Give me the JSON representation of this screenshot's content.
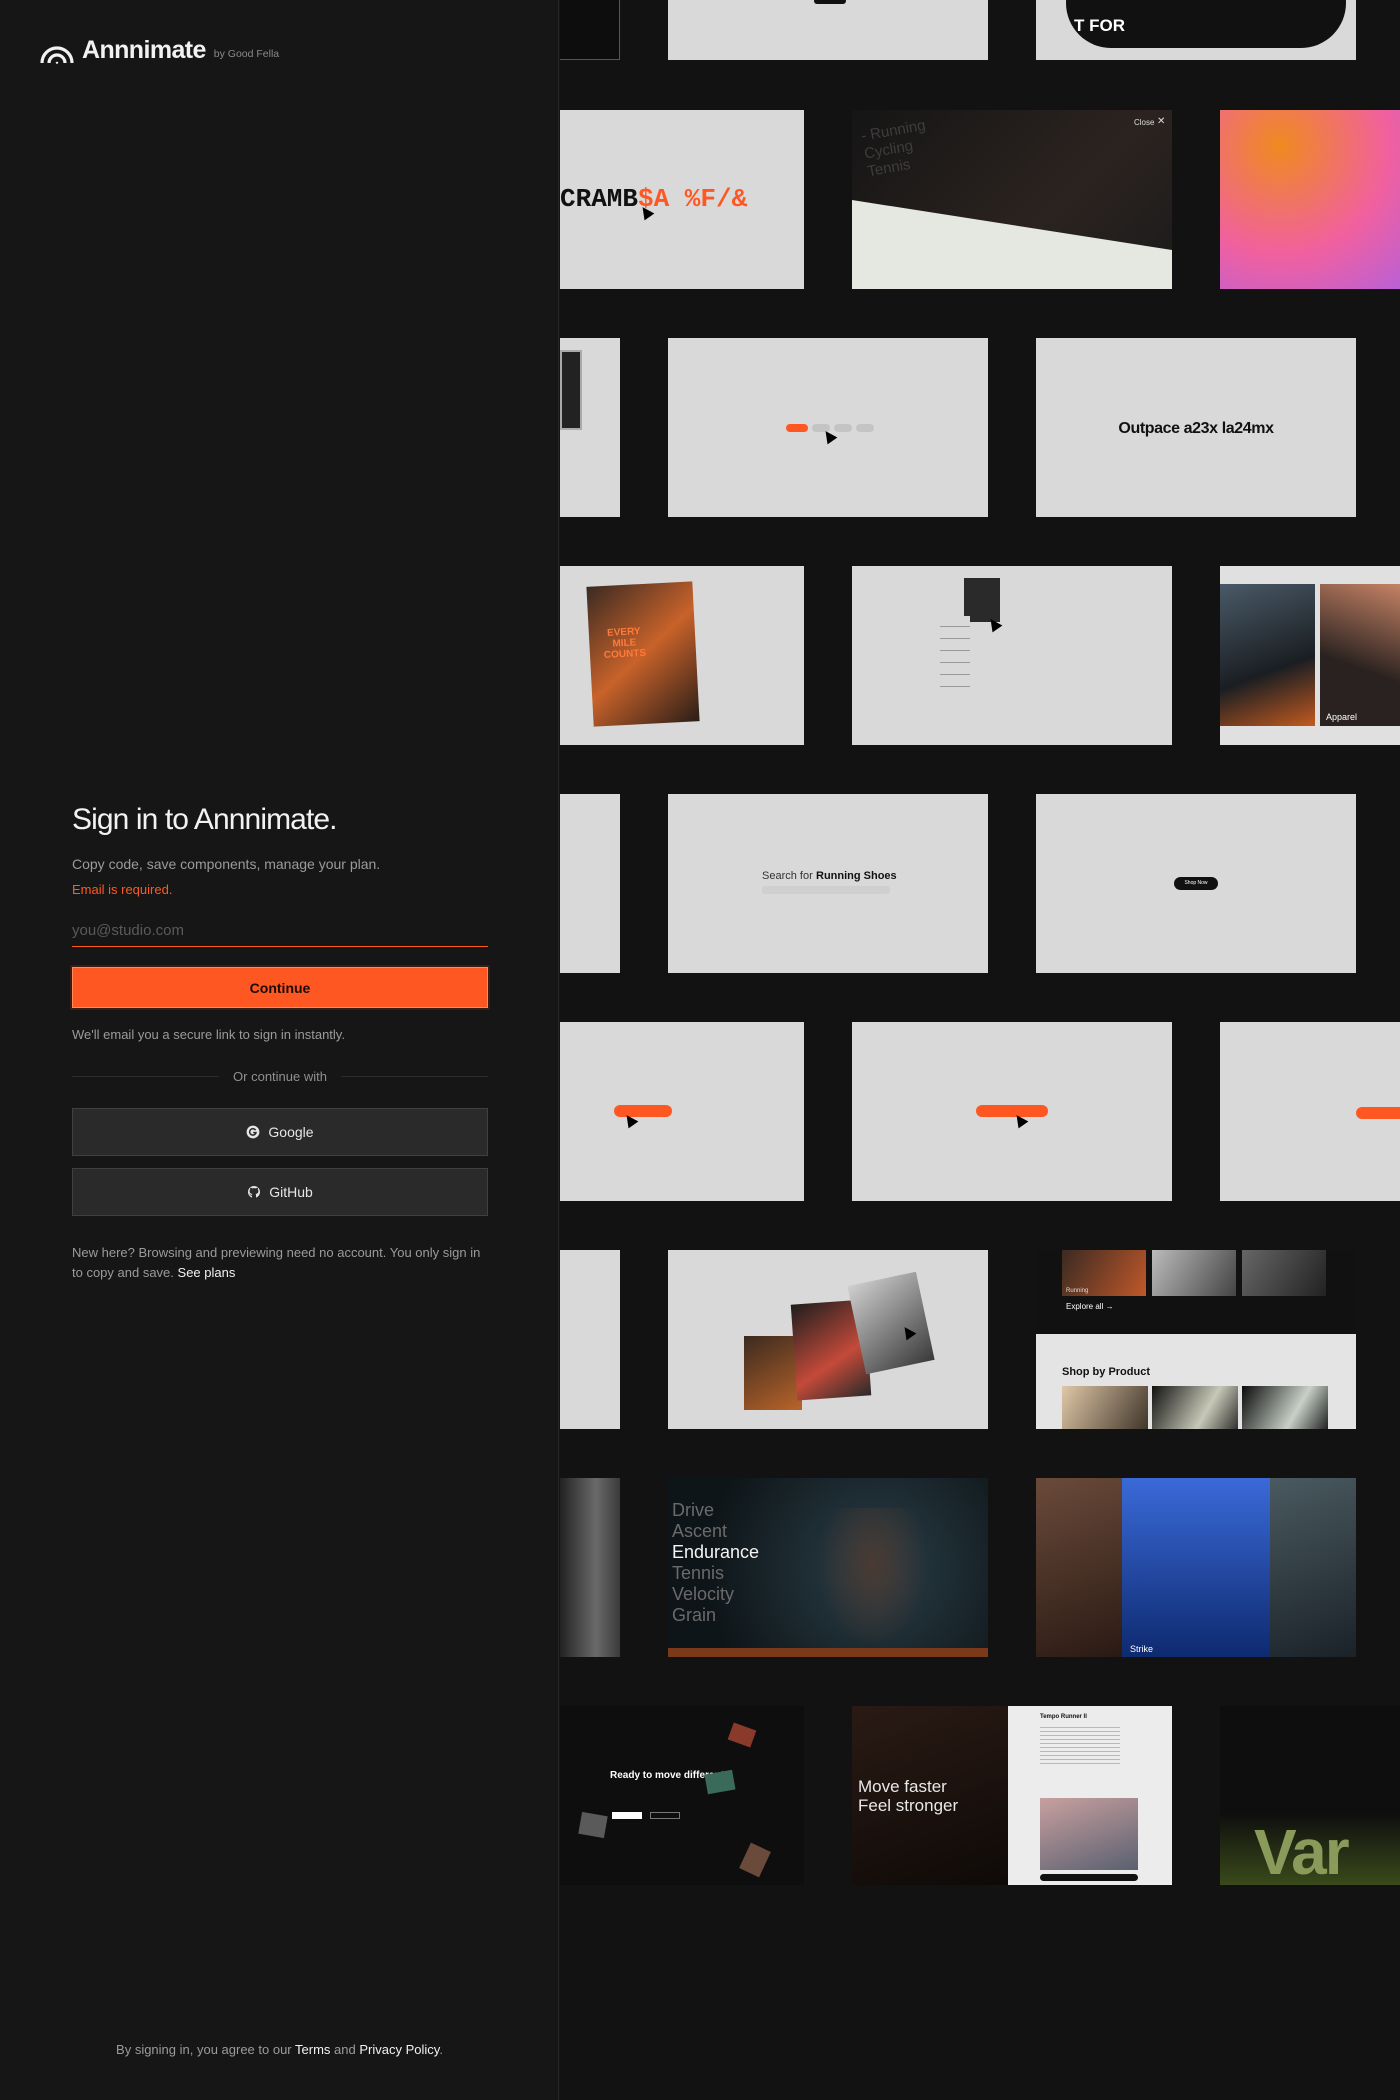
{
  "brand": {
    "name": "Annnimate",
    "by": "by Good Fella"
  },
  "signin": {
    "title": "Sign in to Annnimate.",
    "subtitle": "Copy code, save components, manage your plan.",
    "error": "Email is required.",
    "email_placeholder": "you@studio.com",
    "email_value": "",
    "continue_label": "Continue",
    "hint": "We'll email you a secure link to sign in instantly.",
    "divider": "Or continue with",
    "google_label": "Google",
    "github_label": "GitHub",
    "newhere_text": "New here? Browsing and previewing need no account. You only sign in to copy and save.",
    "see_plans": "See plans"
  },
  "legal": {
    "prefix": "By signing in, you agree to our",
    "terms": "Terms",
    "and": "and",
    "privacy": "Privacy Policy",
    "period": "."
  },
  "colors": {
    "accent": "#ff5722",
    "background": "#161616",
    "tile": "#d9d9d9"
  },
  "gallery": {
    "t1_text": "T FOR",
    "scramble": "CRAMB",
    "scramble_accent": "$A %F/&",
    "menu_items": [
      "- Running",
      "Cycling",
      "Tennis"
    ],
    "close": "Close",
    "outpace": "Outpace a23x la24mx",
    "every_mile": "EVERY MILE COUNTS",
    "apparel": "Apparel",
    "search_for": "Search for",
    "search_term": "Running Shoes",
    "shop_now": "Shop Now",
    "explore_all": "Explore all →",
    "running": "Running",
    "shop_by_product": "Shop by Product",
    "word_list": [
      "Drive",
      "Ascent",
      "Endurance",
      "Tennis",
      "Velocity",
      "Grain"
    ],
    "strike": "Strike",
    "ready": "Ready to move different?",
    "move_faster": "Move faster",
    "feel_stronger": "Feel stronger",
    "tempo": "Tempo Runner II",
    "var": "Var"
  }
}
